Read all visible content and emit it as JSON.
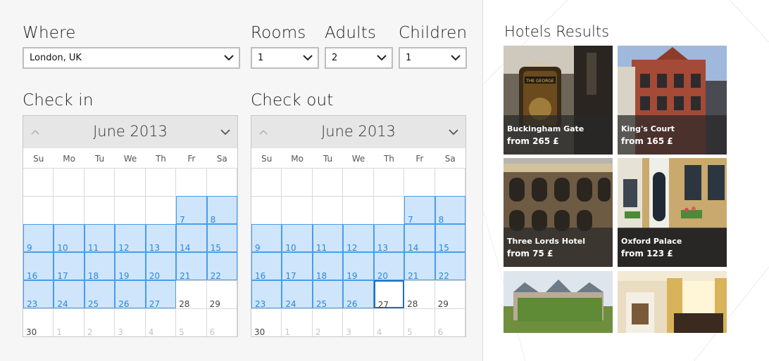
{
  "form": {
    "where_label": "Where",
    "where_value": "London, UK",
    "rooms_label": "Rooms",
    "rooms_value": "1",
    "adults_label": "Adults",
    "adults_value": "2",
    "children_label": "Children",
    "children_value": "1"
  },
  "checkin": {
    "label": "Check in",
    "month": "June 2013",
    "weekdays": [
      "Su",
      "Mo",
      "Tu",
      "We",
      "Th",
      "Fr",
      "Sa"
    ],
    "days": [
      "",
      "",
      "",
      "",
      "",
      "",
      "",
      "",
      "",
      "",
      "",
      "",
      "7",
      "8",
      "9",
      "10",
      "11",
      "12",
      "13",
      "14",
      "15",
      "16",
      "17",
      "18",
      "19",
      "20",
      "21",
      "22",
      "23",
      "24",
      "25",
      "26",
      "27",
      "28",
      "29",
      "30",
      "1",
      "2",
      "3",
      "4",
      "5",
      "6"
    ],
    "selected_range": [
      "7",
      "27"
    ],
    "today": ""
  },
  "checkout": {
    "label": "Check out",
    "month": "June 2013",
    "weekdays": [
      "Su",
      "Mo",
      "Tu",
      "We",
      "Th",
      "Fr",
      "Sa"
    ],
    "days": [
      "",
      "",
      "",
      "",
      "",
      "",
      "",
      "",
      "",
      "",
      "",
      "",
      "7",
      "8",
      "9",
      "10",
      "11",
      "12",
      "13",
      "14",
      "15",
      "16",
      "17",
      "18",
      "19",
      "20",
      "21",
      "22",
      "23",
      "24",
      "25",
      "26",
      "27",
      "28",
      "29",
      "30",
      "1",
      "2",
      "3",
      "4",
      "5",
      "6"
    ],
    "selected_range": [
      "7",
      "26"
    ],
    "today": "27"
  },
  "hotels": {
    "title": "Hotels Results",
    "items": [
      {
        "name": "Buckingham Gate",
        "price": "from 265 £"
      },
      {
        "name": "King's Court",
        "price": "from 165 £"
      },
      {
        "name": "Three Lords Hotel",
        "price": "from 75 £"
      },
      {
        "name": "Oxford Palace",
        "price": "from 123 £"
      },
      {
        "name": "",
        "price": ""
      },
      {
        "name": "",
        "price": ""
      }
    ],
    "sign_text": "THE GEORGE",
    "sign_year": "EST 1807"
  }
}
